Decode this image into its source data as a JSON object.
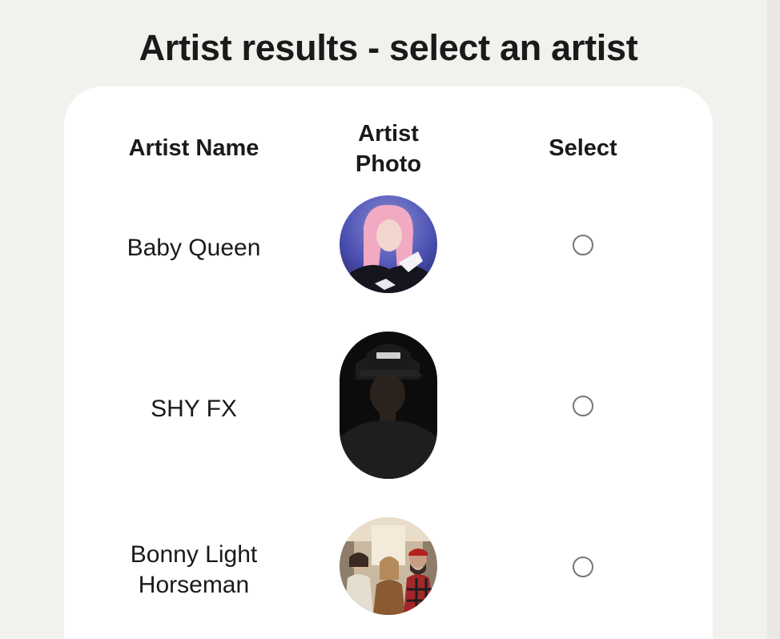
{
  "page": {
    "title": "Artist results - select an artist"
  },
  "table": {
    "headers": {
      "name": "Artist Name",
      "photo_line1": "Artist",
      "photo_line2": "Photo",
      "select": "Select"
    },
    "rows": [
      {
        "name": "Baby Queen",
        "photo": "baby-queen-portrait",
        "selected": false
      },
      {
        "name": "SHY FX",
        "photo": "shy-fx-portrait",
        "selected": false
      },
      {
        "name_line1": "Bonny Light",
        "name_line2": "Horseman",
        "photo": "bonny-light-horseman-group-photo",
        "selected": false
      }
    ]
  }
}
